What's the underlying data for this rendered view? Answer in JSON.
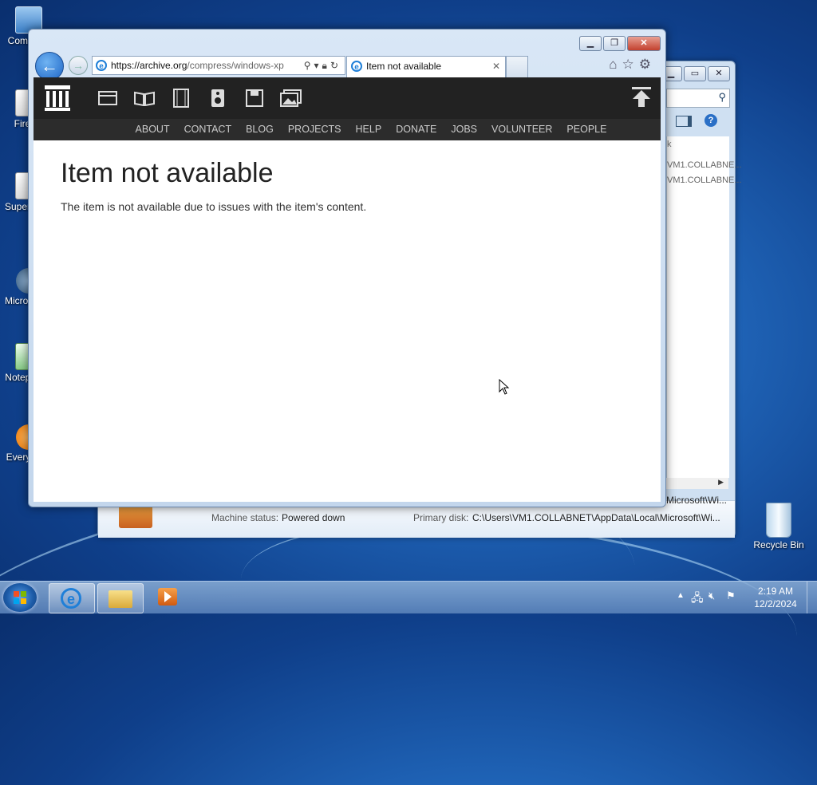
{
  "desktop": {
    "icons": [
      {
        "label": "Computer"
      },
      {
        "label": "Firefox"
      },
      {
        "label": "SuperAntiSpyware"
      },
      {
        "label": "Microsoft Visual"
      },
      {
        "label": "Notepad++"
      },
      {
        "label": "Everything"
      }
    ],
    "recycle_bin": "Recycle Bin"
  },
  "background_window": {
    "rows": [
      "VM1.COLLABNE...",
      "VM1.COLLABNE..."
    ],
    "fragment": "k",
    "status": {
      "machine_status_label": "Machine status:",
      "machine_status_value": "Powered down",
      "primary_disk_label": "Primary disk:",
      "primary_disk_value": "C:\\Users\\VM1.COLLABNET\\AppData\\Local\\Microsoft\\Wi...",
      "top_right_value": "Microsoft\\Wi..."
    }
  },
  "browser": {
    "address": {
      "scheme": "https://",
      "host": "archive.org",
      "path": "/compress/windows-xp"
    },
    "tab_title": "Item not available",
    "nav_menu": [
      "ABOUT",
      "CONTACT",
      "BLOG",
      "PROJECTS",
      "HELP",
      "DONATE",
      "JOBS",
      "VOLUNTEER",
      "PEOPLE"
    ],
    "page": {
      "heading": "Item not available",
      "message": "The item is not available due to issues with the item's content."
    }
  },
  "taskbar": {
    "clock_time": "2:19 AM",
    "clock_date": "12/2/2024"
  },
  "colors": {
    "ia_nav": "#222222",
    "ia_menu": "#2c2c2c",
    "ie_back_blue": "#1d65c6"
  }
}
